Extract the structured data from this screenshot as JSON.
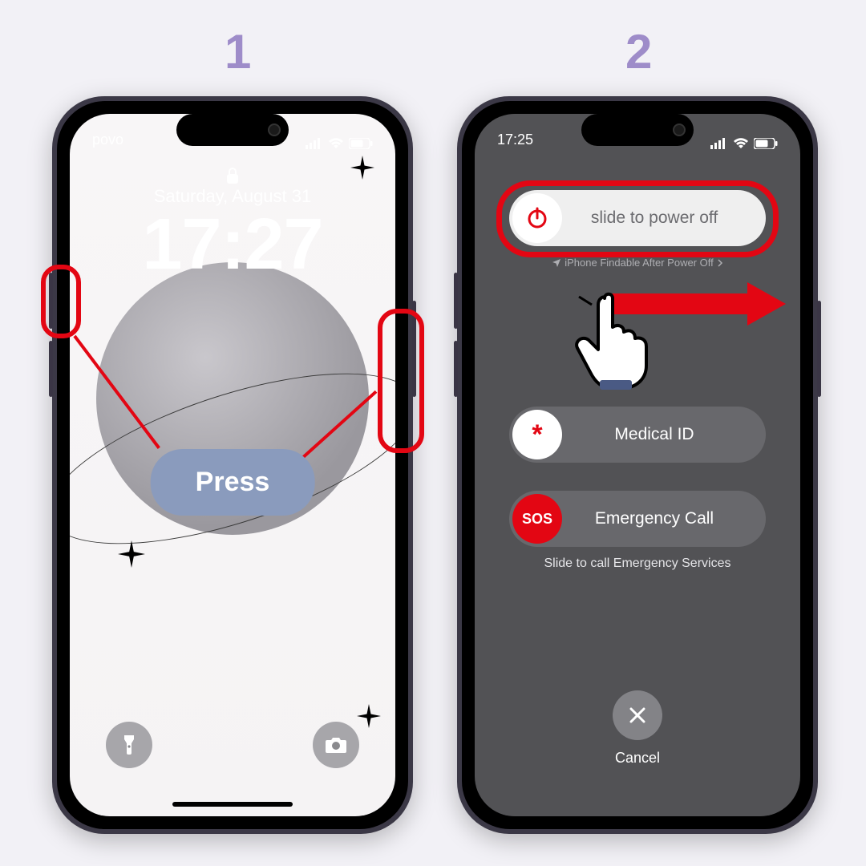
{
  "steps": {
    "one": "1",
    "two": "2"
  },
  "lockscreen": {
    "carrier": "povo",
    "date": "Saturday, August 31",
    "time": "17:27",
    "press_label": "Press"
  },
  "poweroff": {
    "status_time": "17:25",
    "slide_power_label": "slide to power off",
    "findable_hint": "iPhone Findable After Power Off",
    "medical_label": "Medical ID",
    "medical_icon": "*",
    "sos_icon": "SOS",
    "emergency_label": "Emergency Call",
    "sos_hint": "Slide to call Emergency Services",
    "cancel_label": "Cancel"
  }
}
